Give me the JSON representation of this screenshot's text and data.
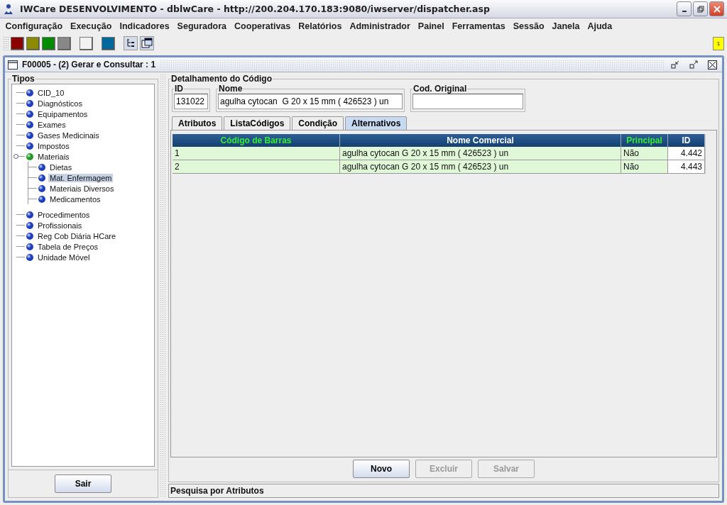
{
  "window": {
    "title": "IWCare DESENVOLVIMENTO - dblwCare - http://200.204.170.183:9080/iwserver/dispatcher.asp"
  },
  "menu": [
    "Configuração",
    "Execução",
    "Indicadores",
    "Seguradora",
    "Cooperativas",
    "Relatórios",
    "Administrador",
    "Painel",
    "Ferramentas",
    "Sessão",
    "Janela",
    "Ajuda"
  ],
  "toolbar": {
    "swatches": [
      {
        "color": "#8b0000"
      },
      {
        "color": "#8b8b00"
      },
      {
        "color": "#008b00"
      },
      {
        "color": "#888888"
      },
      {
        "color": "#f2f2f2"
      },
      {
        "color": "#00689b"
      }
    ],
    "badge": "1"
  },
  "frame": {
    "title": "F00005 - (2) Gerar e Consultar : 1"
  },
  "tree": {
    "title": "Tipos",
    "items": [
      {
        "label": "CID_10",
        "selected": false,
        "color": "#1f3fbf"
      },
      {
        "label": "Diagnósticos",
        "selected": false,
        "color": "#1f3fbf"
      },
      {
        "label": "Equipamentos",
        "selected": false,
        "color": "#1f3fbf"
      },
      {
        "label": "Exames",
        "selected": false,
        "color": "#1f3fbf"
      },
      {
        "label": "Gases Medicinais",
        "selected": false,
        "color": "#1f3fbf"
      },
      {
        "label": "Impostos",
        "selected": false,
        "color": "#1f3fbf"
      },
      {
        "label": "Materiais",
        "selected": false,
        "color": "#1e9a1e",
        "expanded": true,
        "children": [
          {
            "label": "Dietas",
            "selected": false,
            "color": "#1f3fbf"
          },
          {
            "label": "Mat. Enfermagem",
            "selected": true,
            "color": "#1f3fbf"
          },
          {
            "label": "Materiais Diversos",
            "selected": false,
            "color": "#1f3fbf"
          },
          {
            "label": "Medicamentos",
            "selected": false,
            "color": "#1f3fbf"
          }
        ]
      },
      {
        "label": "Procedimentos",
        "selected": false,
        "color": "#1f3fbf"
      },
      {
        "label": "Profissionais",
        "selected": false,
        "color": "#1f3fbf"
      },
      {
        "label": "Reg Cob Diária HCare",
        "selected": false,
        "color": "#1f3fbf"
      },
      {
        "label": "Tabela de Preços",
        "selected": false,
        "color": "#1f3fbf"
      },
      {
        "label": "Unidade Móvel",
        "selected": false,
        "color": "#1f3fbf"
      }
    ],
    "button": "Sair"
  },
  "detail": {
    "title": "Detalhamento do Código",
    "fields": [
      {
        "label": "ID",
        "value": "131022"
      },
      {
        "label": "Nome",
        "value": "agulha cytocan  G 20 x 15 mm ( 426523 ) un"
      },
      {
        "label": "Cod. Original"
      }
    ],
    "tabs": [
      {
        "label": "Atributos",
        "selected": false
      },
      {
        "label": "ListaCódigos",
        "selected": false
      },
      {
        "label": "Condição",
        "selected": false
      },
      {
        "label": "Alternativos",
        "selected": true
      }
    ],
    "table": {
      "columns": [
        {
          "label": "Código de Barras",
          "highlighted": true,
          "kind": "text"
        },
        {
          "label": "Nome Comercial",
          "highlighted": false,
          "kind": "text"
        },
        {
          "label": "Principal",
          "highlighted": true,
          "kind": "text"
        },
        {
          "label": "ID",
          "highlighted": false,
          "kind": "number"
        }
      ],
      "rows": [
        [
          "1",
          "agulha cytocan  G 20 x 15 mm ( 426523 ) un",
          "Não",
          "4.442"
        ],
        [
          "2",
          "agulha cytocan  G 20 x 15 mm ( 426523 ) un",
          "Não",
          "4.443"
        ]
      ]
    },
    "buttons": [
      {
        "label": "Novo",
        "disabled": false
      },
      {
        "label": "Excluir",
        "disabled": true
      },
      {
        "label": "Salvar",
        "disabled": true
      }
    ],
    "status": "Pesquisa por Atributos"
  }
}
